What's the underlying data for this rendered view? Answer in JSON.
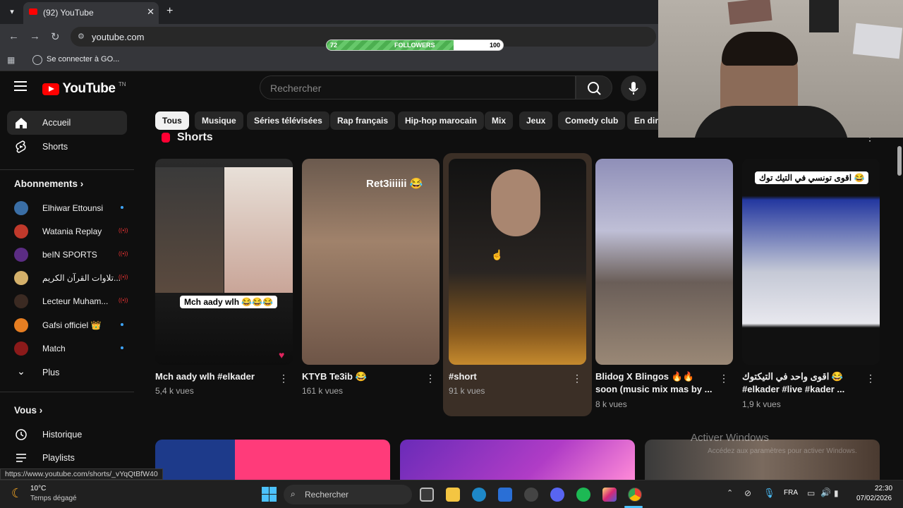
{
  "browser": {
    "tab_title": "(92) YouTube",
    "url": "youtube.com",
    "bookmark_label": "Se connecter à GO..."
  },
  "overlay": {
    "followers_label": "FOLLOWERS",
    "followers_current": "72",
    "followers_goal": "100",
    "followers_progress": 0.72
  },
  "youtube": {
    "logo_text": "YouTube",
    "country_code": "TN",
    "search_placeholder": "Rechercher",
    "sidebar": {
      "main": [
        {
          "label": "Accueil",
          "icon": "home-icon"
        },
        {
          "label": "Shorts",
          "icon": "shorts-icon"
        }
      ],
      "subscriptions_heading": "Abonnements",
      "subscriptions": [
        {
          "label": "Elhiwar Ettounsi",
          "badge": "dot",
          "color": "#3a6ea5"
        },
        {
          "label": "Watania Replay",
          "badge": "live",
          "color": "#c0392b"
        },
        {
          "label": "beIN SPORTS",
          "badge": "live",
          "color": "#5b2c83"
        },
        {
          "label": "تلاوات القرآن الكريم...",
          "badge": "live",
          "color": "#d4b06a"
        },
        {
          "label": "Lecteur Muham...",
          "badge": "live",
          "color": "#3b2a22"
        },
        {
          "label": "Gafsi officiel 👑",
          "badge": "dot",
          "color": "#e67e22"
        },
        {
          "label": "Match",
          "badge": "dot",
          "color": "#8b1a1a"
        }
      ],
      "more_label": "Plus",
      "you_heading": "Vous",
      "you_items": [
        {
          "label": "Historique",
          "icon": "history-icon"
        },
        {
          "label": "Playlists",
          "icon": "playlists-icon"
        }
      ]
    },
    "chips": [
      "Tous",
      "Musique",
      "Séries télévisées",
      "Rap français",
      "Hip-hop marocain",
      "Mix",
      "Jeux",
      "Comedy club",
      "En direct"
    ],
    "shorts_heading": "Shorts",
    "shorts": [
      {
        "title": "Mch aady wlh #elkader",
        "views": "5,4 k vues",
        "overlay": "Mch aady wlh 😂😂😂"
      },
      {
        "title": "KTYB Te3ib 😂",
        "views": "161 k vues",
        "overlay": "Ret3iiiiii 😂"
      },
      {
        "title": "#short",
        "views": "91 k vues",
        "overlay": ""
      },
      {
        "title": "Blidog X Blingos 🔥🔥 soon (music mix mas by ...",
        "views": "8 k vues",
        "overlay": ""
      },
      {
        "title": "اقوى واحد في التيكتوك 😂 #elkader #live #kader ...",
        "views": "1,9 k vues",
        "overlay": "اقوى تونسي في التيك توك 😂"
      }
    ],
    "status_url": "https://www.youtube.com/shorts/_vYqQtBfW40"
  },
  "windows": {
    "watermark_title": "Activer Windows",
    "watermark_sub": "Accédez aux paramètres pour activer Windows.",
    "weather_temp": "10°C",
    "weather_desc": "Temps dégagé",
    "search_placeholder": "Rechercher",
    "language": "FRA",
    "time": "22:30",
    "date": "07/02/2026"
  }
}
